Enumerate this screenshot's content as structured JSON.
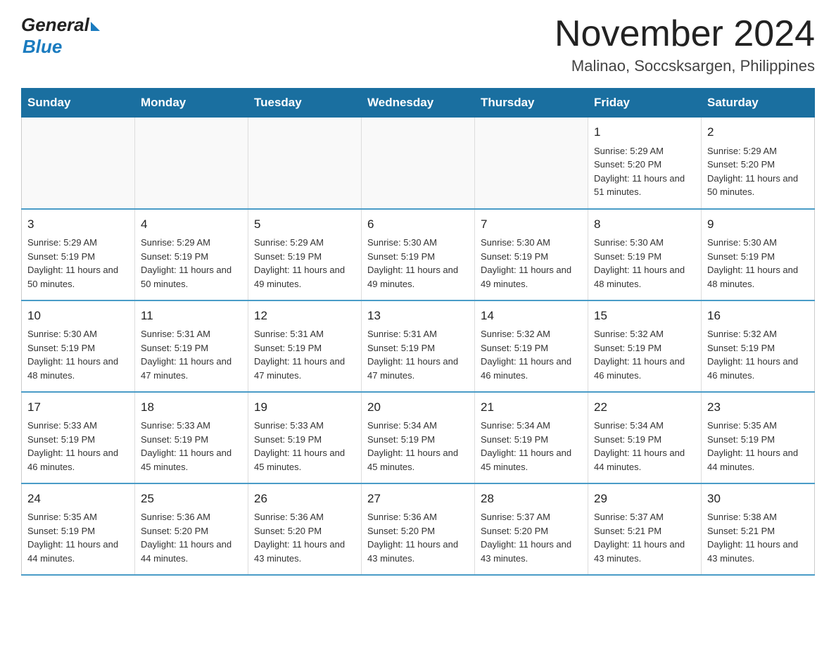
{
  "header": {
    "logo": {
      "general": "General",
      "blue": "Blue"
    },
    "title": "November 2024",
    "location": "Malinao, Soccsksargen, Philippines"
  },
  "days_of_week": [
    "Sunday",
    "Monday",
    "Tuesday",
    "Wednesday",
    "Thursday",
    "Friday",
    "Saturday"
  ],
  "weeks": [
    {
      "days": [
        {
          "number": "",
          "sunrise": "",
          "sunset": "",
          "daylight": ""
        },
        {
          "number": "",
          "sunrise": "",
          "sunset": "",
          "daylight": ""
        },
        {
          "number": "",
          "sunrise": "",
          "sunset": "",
          "daylight": ""
        },
        {
          "number": "",
          "sunrise": "",
          "sunset": "",
          "daylight": ""
        },
        {
          "number": "",
          "sunrise": "",
          "sunset": "",
          "daylight": ""
        },
        {
          "number": "1",
          "sunrise": "Sunrise: 5:29 AM",
          "sunset": "Sunset: 5:20 PM",
          "daylight": "Daylight: 11 hours and 51 minutes."
        },
        {
          "number": "2",
          "sunrise": "Sunrise: 5:29 AM",
          "sunset": "Sunset: 5:20 PM",
          "daylight": "Daylight: 11 hours and 50 minutes."
        }
      ]
    },
    {
      "days": [
        {
          "number": "3",
          "sunrise": "Sunrise: 5:29 AM",
          "sunset": "Sunset: 5:19 PM",
          "daylight": "Daylight: 11 hours and 50 minutes."
        },
        {
          "number": "4",
          "sunrise": "Sunrise: 5:29 AM",
          "sunset": "Sunset: 5:19 PM",
          "daylight": "Daylight: 11 hours and 50 minutes."
        },
        {
          "number": "5",
          "sunrise": "Sunrise: 5:29 AM",
          "sunset": "Sunset: 5:19 PM",
          "daylight": "Daylight: 11 hours and 49 minutes."
        },
        {
          "number": "6",
          "sunrise": "Sunrise: 5:30 AM",
          "sunset": "Sunset: 5:19 PM",
          "daylight": "Daylight: 11 hours and 49 minutes."
        },
        {
          "number": "7",
          "sunrise": "Sunrise: 5:30 AM",
          "sunset": "Sunset: 5:19 PM",
          "daylight": "Daylight: 11 hours and 49 minutes."
        },
        {
          "number": "8",
          "sunrise": "Sunrise: 5:30 AM",
          "sunset": "Sunset: 5:19 PM",
          "daylight": "Daylight: 11 hours and 48 minutes."
        },
        {
          "number": "9",
          "sunrise": "Sunrise: 5:30 AM",
          "sunset": "Sunset: 5:19 PM",
          "daylight": "Daylight: 11 hours and 48 minutes."
        }
      ]
    },
    {
      "days": [
        {
          "number": "10",
          "sunrise": "Sunrise: 5:30 AM",
          "sunset": "Sunset: 5:19 PM",
          "daylight": "Daylight: 11 hours and 48 minutes."
        },
        {
          "number": "11",
          "sunrise": "Sunrise: 5:31 AM",
          "sunset": "Sunset: 5:19 PM",
          "daylight": "Daylight: 11 hours and 47 minutes."
        },
        {
          "number": "12",
          "sunrise": "Sunrise: 5:31 AM",
          "sunset": "Sunset: 5:19 PM",
          "daylight": "Daylight: 11 hours and 47 minutes."
        },
        {
          "number": "13",
          "sunrise": "Sunrise: 5:31 AM",
          "sunset": "Sunset: 5:19 PM",
          "daylight": "Daylight: 11 hours and 47 minutes."
        },
        {
          "number": "14",
          "sunrise": "Sunrise: 5:32 AM",
          "sunset": "Sunset: 5:19 PM",
          "daylight": "Daylight: 11 hours and 46 minutes."
        },
        {
          "number": "15",
          "sunrise": "Sunrise: 5:32 AM",
          "sunset": "Sunset: 5:19 PM",
          "daylight": "Daylight: 11 hours and 46 minutes."
        },
        {
          "number": "16",
          "sunrise": "Sunrise: 5:32 AM",
          "sunset": "Sunset: 5:19 PM",
          "daylight": "Daylight: 11 hours and 46 minutes."
        }
      ]
    },
    {
      "days": [
        {
          "number": "17",
          "sunrise": "Sunrise: 5:33 AM",
          "sunset": "Sunset: 5:19 PM",
          "daylight": "Daylight: 11 hours and 46 minutes."
        },
        {
          "number": "18",
          "sunrise": "Sunrise: 5:33 AM",
          "sunset": "Sunset: 5:19 PM",
          "daylight": "Daylight: 11 hours and 45 minutes."
        },
        {
          "number": "19",
          "sunrise": "Sunrise: 5:33 AM",
          "sunset": "Sunset: 5:19 PM",
          "daylight": "Daylight: 11 hours and 45 minutes."
        },
        {
          "number": "20",
          "sunrise": "Sunrise: 5:34 AM",
          "sunset": "Sunset: 5:19 PM",
          "daylight": "Daylight: 11 hours and 45 minutes."
        },
        {
          "number": "21",
          "sunrise": "Sunrise: 5:34 AM",
          "sunset": "Sunset: 5:19 PM",
          "daylight": "Daylight: 11 hours and 45 minutes."
        },
        {
          "number": "22",
          "sunrise": "Sunrise: 5:34 AM",
          "sunset": "Sunset: 5:19 PM",
          "daylight": "Daylight: 11 hours and 44 minutes."
        },
        {
          "number": "23",
          "sunrise": "Sunrise: 5:35 AM",
          "sunset": "Sunset: 5:19 PM",
          "daylight": "Daylight: 11 hours and 44 minutes."
        }
      ]
    },
    {
      "days": [
        {
          "number": "24",
          "sunrise": "Sunrise: 5:35 AM",
          "sunset": "Sunset: 5:19 PM",
          "daylight": "Daylight: 11 hours and 44 minutes."
        },
        {
          "number": "25",
          "sunrise": "Sunrise: 5:36 AM",
          "sunset": "Sunset: 5:20 PM",
          "daylight": "Daylight: 11 hours and 44 minutes."
        },
        {
          "number": "26",
          "sunrise": "Sunrise: 5:36 AM",
          "sunset": "Sunset: 5:20 PM",
          "daylight": "Daylight: 11 hours and 43 minutes."
        },
        {
          "number": "27",
          "sunrise": "Sunrise: 5:36 AM",
          "sunset": "Sunset: 5:20 PM",
          "daylight": "Daylight: 11 hours and 43 minutes."
        },
        {
          "number": "28",
          "sunrise": "Sunrise: 5:37 AM",
          "sunset": "Sunset: 5:20 PM",
          "daylight": "Daylight: 11 hours and 43 minutes."
        },
        {
          "number": "29",
          "sunrise": "Sunrise: 5:37 AM",
          "sunset": "Sunset: 5:21 PM",
          "daylight": "Daylight: 11 hours and 43 minutes."
        },
        {
          "number": "30",
          "sunrise": "Sunrise: 5:38 AM",
          "sunset": "Sunset: 5:21 PM",
          "daylight": "Daylight: 11 hours and 43 minutes."
        }
      ]
    }
  ]
}
